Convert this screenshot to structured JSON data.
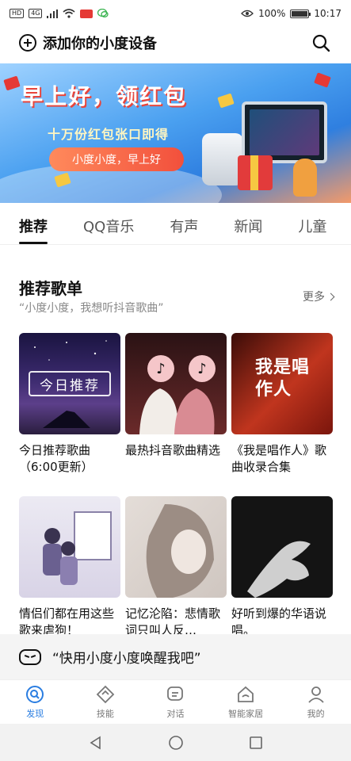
{
  "status_bar": {
    "hd": "HD",
    "network": "4G",
    "battery_percent_label": "100%",
    "battery_level": 1.0,
    "time": "10:17"
  },
  "top_bar": {
    "title": "添加你的小度设备"
  },
  "banner": {
    "title": "早上好，领红包",
    "subtitle": "十万份红包张口即得",
    "pill_text": "小度小度，早上好",
    "slide_count": 6,
    "active_slide": 1
  },
  "tabs": [
    {
      "label": "推荐",
      "active": true
    },
    {
      "label": "QQ音乐",
      "active": false
    },
    {
      "label": "有声",
      "active": false
    },
    {
      "label": "新闻",
      "active": false
    },
    {
      "label": "儿童",
      "active": false
    }
  ],
  "section": {
    "title": "推荐歌单",
    "subtitle": "“小度小度，我想听抖音歌曲”",
    "more_label": "更多"
  },
  "playlists": [
    {
      "caption": "今日推荐歌曲（6:00更新）",
      "cover_label": "今日推荐"
    },
    {
      "caption": "最热抖音歌曲精选"
    },
    {
      "caption": "《我是唱作人》歌曲收录合集",
      "cover_label": "我是唱作人"
    },
    {
      "caption": "情侣们都在用这些歌来虐狗！"
    },
    {
      "caption": "记忆沦陷：悲情歌词只叫人反…"
    },
    {
      "caption": "好听到爆的华语说唱。"
    }
  ],
  "voice_bar": {
    "text": "“快用小度小度唤醒我吧”"
  },
  "bottom_nav": [
    {
      "label": "发现",
      "icon": "discover-icon",
      "active": true
    },
    {
      "label": "技能",
      "icon": "skill-icon",
      "active": false
    },
    {
      "label": "对话",
      "icon": "chat-icon",
      "active": false
    },
    {
      "label": "智能家居",
      "icon": "home-icon",
      "active": false
    },
    {
      "label": "我的",
      "icon": "profile-icon",
      "active": false
    }
  ],
  "colors": {
    "accent": "#2a7de1",
    "banner_red": "#e8453c"
  }
}
